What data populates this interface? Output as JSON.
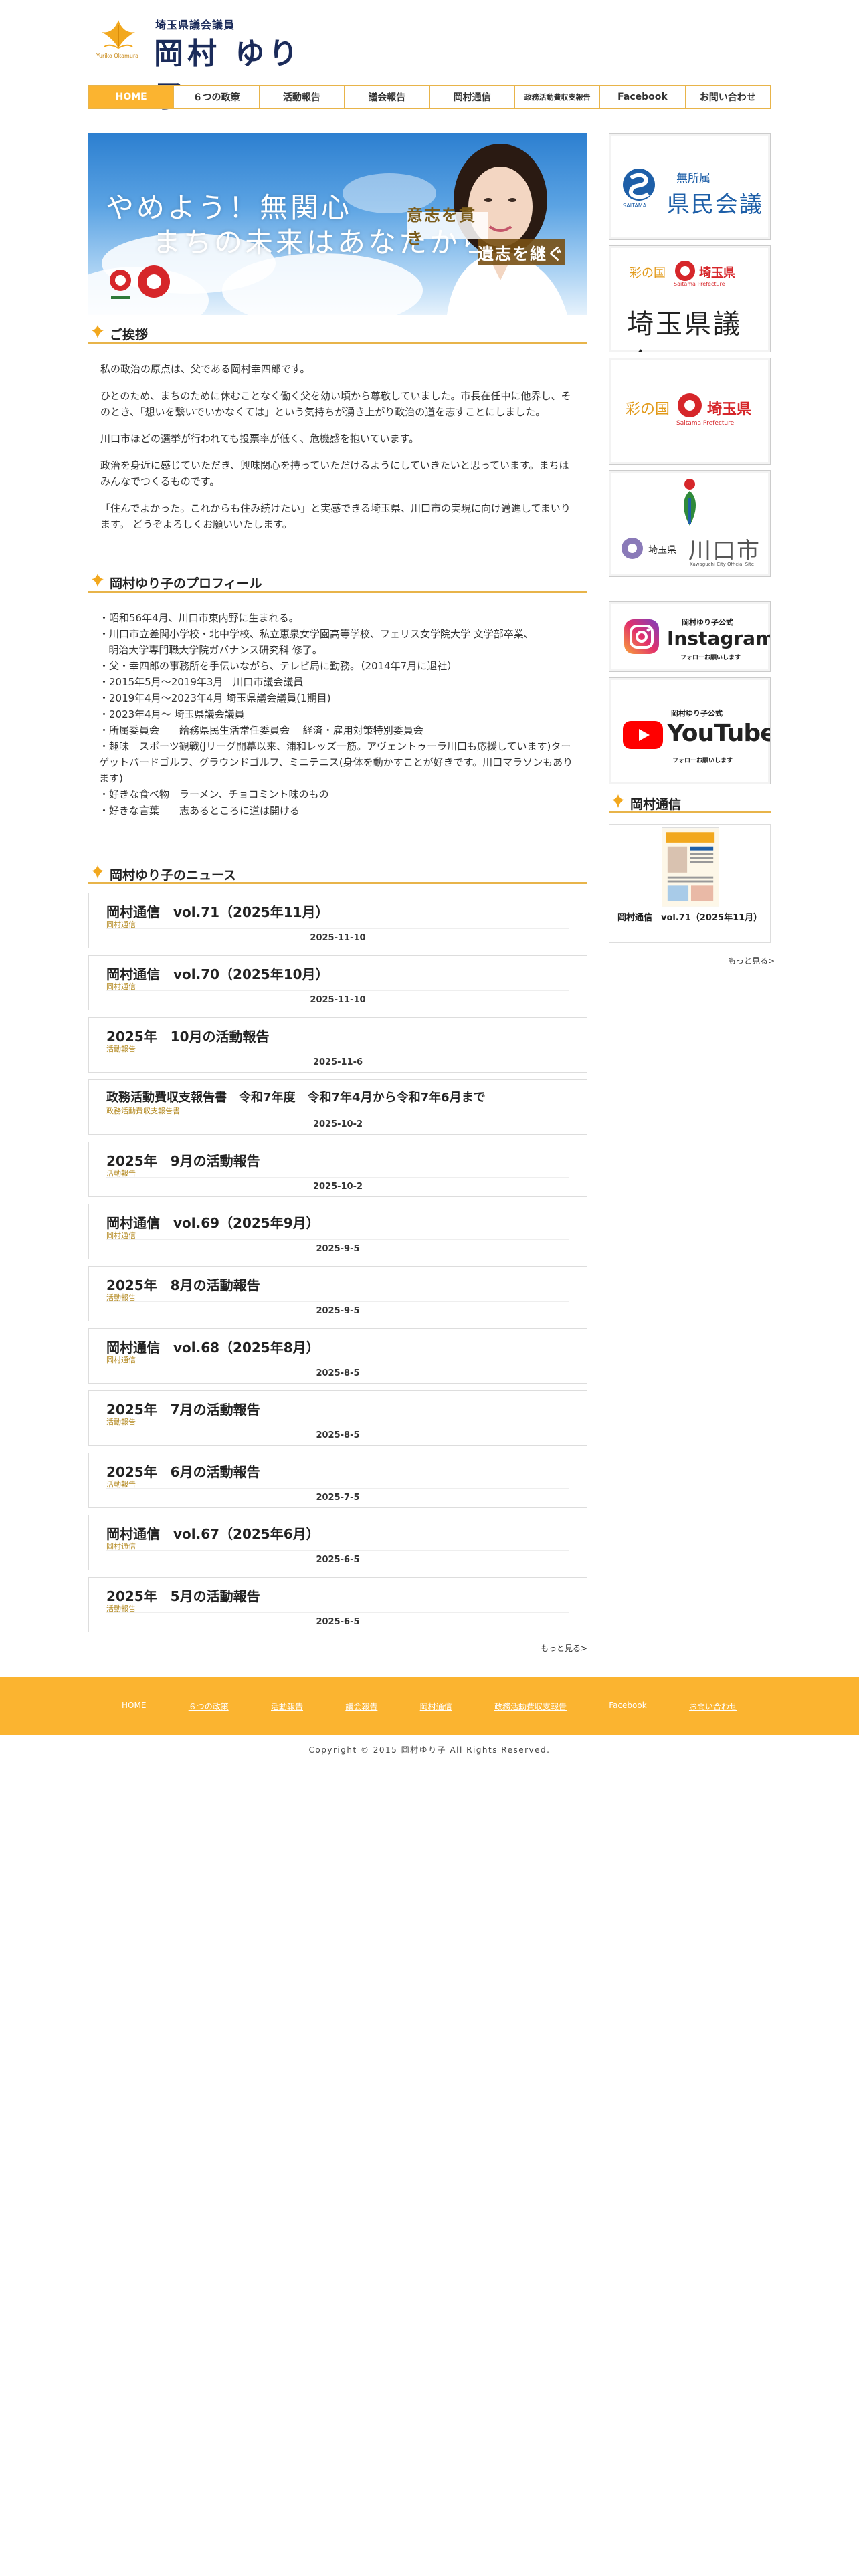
{
  "header": {
    "subtitle": "埼玉県議会議員",
    "name": "岡村 ゆり子",
    "logo_text": "Yuriko Okamura"
  },
  "nav": [
    "HOME",
    "６つの政策",
    "活動報告",
    "議会報告",
    "岡村通信",
    "政務活動費収支報告",
    "Facebook",
    "お問い合わせ"
  ],
  "hero": {
    "line1": "やめよう！無関心",
    "line2": "まちの未来はあなたから",
    "stamp1": "意志を貫き",
    "stamp2": "遺志を継ぐ"
  },
  "greeting": {
    "title": "ご挨拶",
    "paragraphs": [
      "私の政治の原点は、父である岡村幸四郎です。",
      "ひとのため、まちのために休むことなく働く父を幼い頃から尊敬していました。市長在任中に他界し、そのとき、「想いを繋いでいかなくては」という気持ちが湧き上がり政治の道を志すことにしました。",
      "川口市ほどの選挙が行われても投票率が低く、危機感を抱いています。",
      "政治を身近に感じていただき、興味関心を持っていただけるようにしていきたいと思っています。まちはみんなでつくるものです。",
      "「住んでよかった。これからも住み続けたい」と実感できる埼玉県、川口市の実現に向け邁進してまいります。 どうぞよろしくお願いいたします。"
    ]
  },
  "profile": {
    "title": "岡村ゆり子のプロフィール",
    "lines": [
      "・昭和56年4月、川口市東内野に生まれる。",
      "・川口市立差間小学校・北中学校、私立恵泉女学園高等学校、フェリス女学院大学 文学部卒業、",
      "   明治大学専門職大学院ガバナンス研究科 修了。",
      "・父・幸四郎の事務所を手伝いながら、テレビ局に勤務。（2014年7月に退社）",
      "・2015年5月〜2019年3月　川口市議会議員",
      "・2019年4月〜2023年4月 埼玉県議会議員(1期目)",
      "・2023年4月〜 埼玉県議会議員",
      "・所属委員会　　給務県民生活常任委員会　 経済・雇用対策特別委員会",
      "・趣味　スポーツ観戦(Jリーグ開幕以来、浦和レッズ一筋。アヴェントゥーラ川口も応援しています)ターゲットバードゴルフ、グラウンドゴルフ、ミニテニス(身体を動かすことが好きです。川口マラソンもあります)",
      "・好きな食べ物　ラーメン、チョコミント味のもの",
      "・好きな言葉　　志あるところに道は開ける"
    ]
  },
  "news": {
    "title": "岡村ゆり子のニュース",
    "more": "もっと見る>",
    "items": [
      {
        "title": "岡村通信　vol.71（2025年11月）",
        "category": "岡村通信",
        "date": "2025-11-10"
      },
      {
        "title": "岡村通信　vol.70（2025年10月）",
        "category": "岡村通信",
        "date": "2025-11-10"
      },
      {
        "title": "2025年　10月の活動報告",
        "category": "活動報告",
        "date": "2025-11-6"
      },
      {
        "title": "政務活動費収支報告書　令和7年度　令和7年4月から令和7年6月まで",
        "category": "政務活動費収支報告書",
        "date": "2025-10-2"
      },
      {
        "title": "2025年　9月の活動報告",
        "category": "活動報告",
        "date": "2025-10-2"
      },
      {
        "title": "岡村通信　vol.69（2025年9月）",
        "category": "岡村通信",
        "date": "2025-9-5"
      },
      {
        "title": "2025年　8月の活動報告",
        "category": "活動報告",
        "date": "2025-9-5"
      },
      {
        "title": "岡村通信　vol.68（2025年8月）",
        "category": "岡村通信",
        "date": "2025-8-5"
      },
      {
        "title": "2025年　7月の活動報告",
        "category": "活動報告",
        "date": "2025-8-5"
      },
      {
        "title": "2025年　6月の活動報告",
        "category": "活動報告",
        "date": "2025-7-5"
      },
      {
        "title": "岡村通信　vol.67（2025年6月）",
        "category": "岡村通信",
        "date": "2025-6-5"
      },
      {
        "title": "2025年　5月の活動報告",
        "category": "活動報告",
        "date": "2025-6-5"
      }
    ]
  },
  "sidebar": {
    "kenmin": {
      "small": "無所属",
      "large": "県民会議",
      "mark": "SAITAMA"
    },
    "gikai": {
      "top": "彩の国",
      "top2": "埼玉県",
      "en": "Saitama Prefecture",
      "large": "埼玉県議会"
    },
    "pref": {
      "top": "彩の国",
      "top2": "埼玉県",
      "en": "Saitama Prefecture"
    },
    "city": {
      "pref": "埼玉県",
      "city": "川口市",
      "en": "Kawaguchi City Official Site"
    },
    "instagram": {
      "small": "岡村ゆり子公式",
      "large": "Instagram",
      "follow": "フォローお願いします"
    },
    "youtube": {
      "small": "岡村ゆり子公式",
      "large": "YouTube",
      "follow": "フォローお願いします"
    },
    "tsushin": {
      "title": "岡村通信",
      "item": "岡村通信　vol.71（2025年11月）",
      "more": "もっと見る>"
    }
  },
  "footer": {
    "links": [
      "HOME",
      "６つの政策",
      "活動報告",
      "議会報告",
      "岡村通信",
      "政務活動費収支報告",
      "Facebook",
      "お問い合わせ"
    ],
    "copyright": "Copyright © 2015 岡村ゆり子 All Rights Reserved."
  },
  "colors": {
    "accent": "#fbb430",
    "navy": "#1b2b5a",
    "red": "#d6262a"
  }
}
